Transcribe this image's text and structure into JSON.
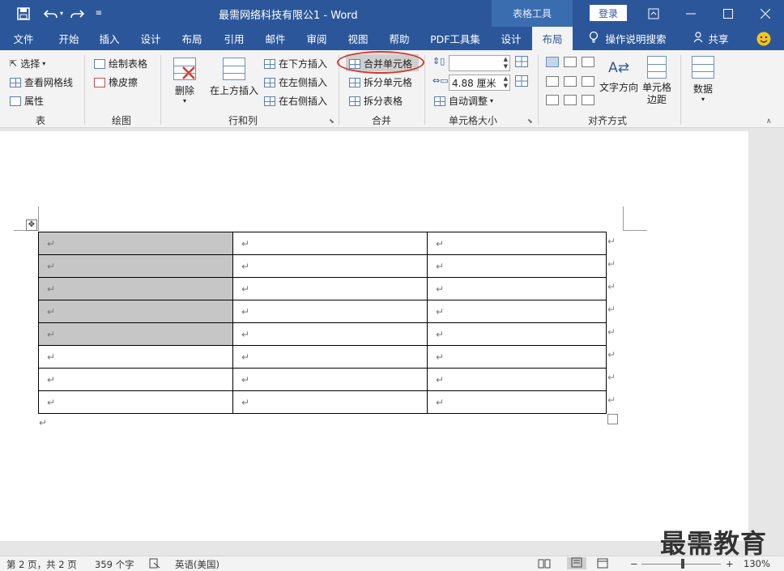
{
  "titlebar": {
    "save_icon": "save-icon",
    "undo_icon": "undo-icon",
    "redo_icon": "redo-icon",
    "customize_icon": "customize-qat-icon",
    "document_title": "最需网络科技有限公1 - Word",
    "tools_tab": "表格工具",
    "login_button": "登录",
    "colors": {
      "bar": "#2b579a",
      "tools_tab": "#3a6db0"
    }
  },
  "tabs": [
    {
      "label": "文件"
    },
    {
      "label": "开始"
    },
    {
      "label": "插入"
    },
    {
      "label": "设计"
    },
    {
      "label": "布局"
    },
    {
      "label": "引用"
    },
    {
      "label": "邮件"
    },
    {
      "label": "审阅"
    },
    {
      "label": "视图"
    },
    {
      "label": "帮助"
    },
    {
      "label": "PDF工具集"
    },
    {
      "label": "设计"
    },
    {
      "label": "布局"
    }
  ],
  "active_tab": "布局",
  "search": {
    "label": "操作说明搜索",
    "icon": "lightbulb-icon"
  },
  "share": {
    "label": "共享",
    "icon": "person-icon"
  },
  "smiley_icon": "smiley-icon",
  "ribbon": {
    "table_group": {
      "label": "表",
      "select": "选择",
      "view_gridlines": "查看网格线",
      "properties": "属性"
    },
    "draw_group": {
      "label": "绘图",
      "draw_table": "绘制表格",
      "eraser": "橡皮擦"
    },
    "rows_cols_group": {
      "label": "行和列",
      "delete": "删除",
      "insert_above": "在上方插入",
      "insert_below": "在下方插入",
      "insert_left": "在左侧插入",
      "insert_right": "在右侧插入"
    },
    "merge_group": {
      "label": "合并",
      "merge_cells": "合并单元格",
      "split_cells": "拆分单元格",
      "split_table": "拆分表格"
    },
    "cell_size_group": {
      "label": "单元格大小",
      "height_value": "",
      "width_value": "4.88 厘米",
      "autofit": "自动调整"
    },
    "alignment_group": {
      "label": "对齐方式",
      "text_direction": "文字方向",
      "cell_margins": "单元格边距"
    },
    "data_group": {
      "label": "数据"
    }
  },
  "table": {
    "rows": 8,
    "cols": 3,
    "cell_mark": "↵",
    "shaded_rows": 5,
    "shade_color": "#c6c6c6"
  },
  "watermark": "最需教育",
  "status": {
    "page": "第 2 页，共 2 页",
    "words": "359 个字",
    "language": "英语(美国)",
    "zoom": "130%",
    "zoom_level": 0.52
  }
}
